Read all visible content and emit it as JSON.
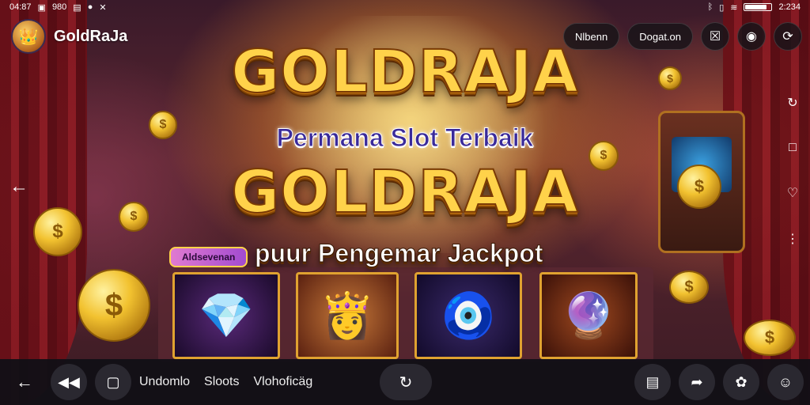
{
  "status_bar": {
    "time_left": "04:87",
    "notification_text": "9",
    "carrier_text": "980",
    "time_right": "2:234",
    "battery_level": 0.85
  },
  "header": {
    "brand_name": "GoldRaJa",
    "logo_icon": "crown-icon",
    "buttons": [
      {
        "label": "Nlbenn"
      },
      {
        "label": "Dogat.on"
      }
    ],
    "icon_buttons": [
      "square-x-icon",
      "controller-icon",
      "share-icon"
    ]
  },
  "banner": {
    "title_top": "GOLDRAJA",
    "subtitle": "Permana Slot Terbaik",
    "title_bottom": "GOLDRAJA",
    "tag_label": "Aldsevenan",
    "tagline": "puur Pengemar Jackpot"
  },
  "tiles": [
    {
      "icon": "gem-icon"
    },
    {
      "icon": "princess-icon"
    },
    {
      "icon": "jewel-amulet-icon"
    },
    {
      "icon": "orb-icon"
    }
  ],
  "side_right_icons": [
    "refresh-icon",
    "square-icon",
    "chat-icon",
    "more-icon"
  ],
  "bottom_nav": {
    "links": [
      "Undomlo",
      "Sloots",
      "Vlohoficäg"
    ]
  },
  "colors": {
    "gold": "#ffd24a",
    "nav_bg": "#121016",
    "accent_purple": "#3a2a9a"
  }
}
